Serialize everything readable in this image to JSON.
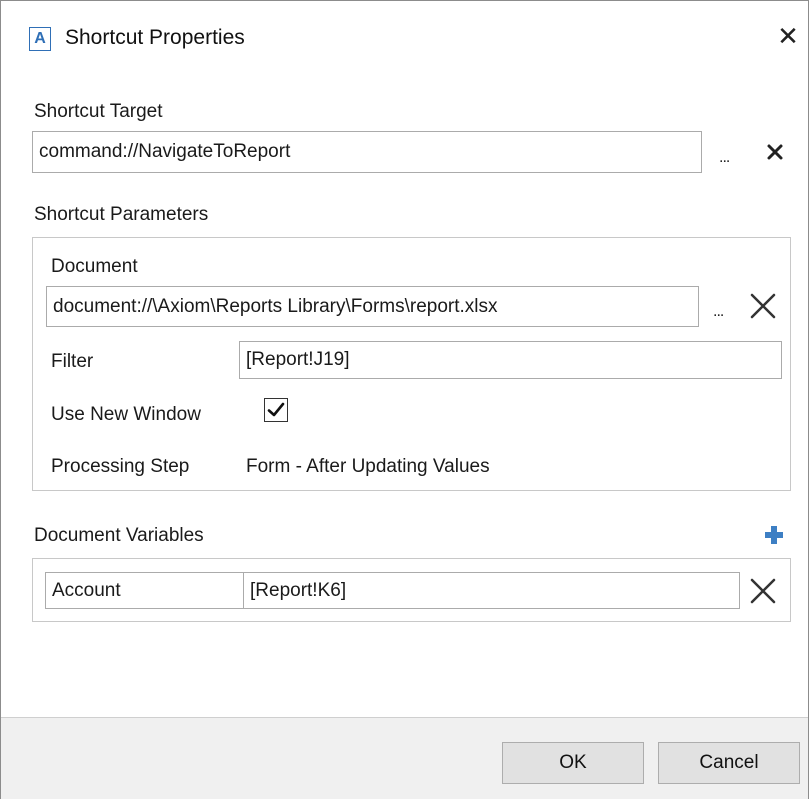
{
  "window": {
    "title": "Shortcut Properties",
    "app_icon_letter": "A",
    "close_glyph": "✕"
  },
  "shortcut_target": {
    "label": "Shortcut Target",
    "value": "command://NavigateToReport",
    "browse_label": "...",
    "clear_glyph": "✕"
  },
  "shortcut_parameters": {
    "label": "Shortcut Parameters",
    "document": {
      "label": "Document",
      "value": "document://\\Axiom\\Reports Library\\Forms\\report.xlsx",
      "browse_label": "..."
    },
    "filter": {
      "label": "Filter",
      "value": "[Report!J19]"
    },
    "use_new_window": {
      "label": "Use New Window",
      "checked": true
    },
    "processing_step": {
      "label": "Processing Step",
      "value": "Form - After Updating Values"
    }
  },
  "document_variables": {
    "label": "Document Variables",
    "add_icon": "plus-icon",
    "rows": [
      {
        "name": "Account",
        "value": "[Report!K6]"
      }
    ]
  },
  "footer": {
    "ok_label": "OK",
    "cancel_label": "Cancel"
  },
  "colors": {
    "accent": "#2f6fb6",
    "footer_bg": "#f0f0f0",
    "button_bg": "#e1e1e1"
  }
}
